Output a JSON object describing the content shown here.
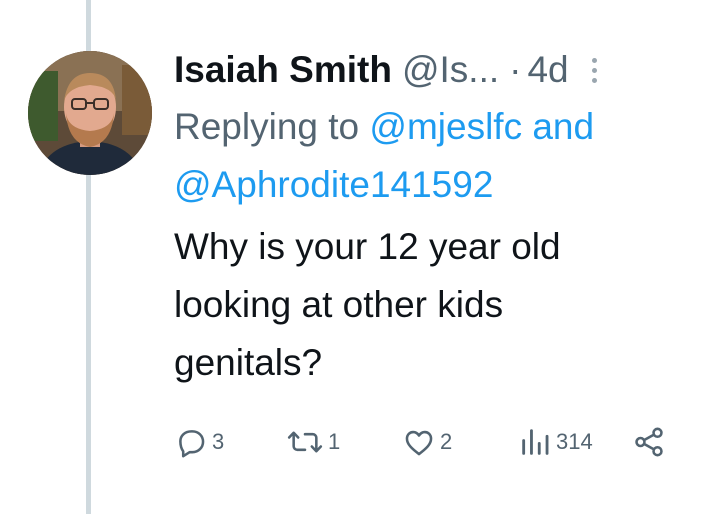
{
  "tweet": {
    "display_name": "Isaiah Smith",
    "handle": "@Is...",
    "separator": "·",
    "time": "4d",
    "replying_prefix": "Replying to",
    "mention_1": "@mjeslfc",
    "mention_joiner": "and",
    "mention_2": "@Aphrodite141592",
    "body_line_1": "Why is your 12 year old",
    "body_line_2": "looking at other kids",
    "body_line_3": "genitals?"
  },
  "actions": {
    "reply_icon": "reply-icon",
    "reply_count": "3",
    "retweet_icon": "retweet-icon",
    "retweet_count": "1",
    "like_icon": "heart-icon",
    "like_count": "2",
    "views_icon": "views-bar-chart-icon",
    "views_count": "314",
    "share_icon": "share-icon"
  },
  "colors": {
    "text_primary": "#0f1419",
    "text_secondary": "#536471",
    "link": "#1d9bf0",
    "thread_line": "#cfd9de"
  }
}
